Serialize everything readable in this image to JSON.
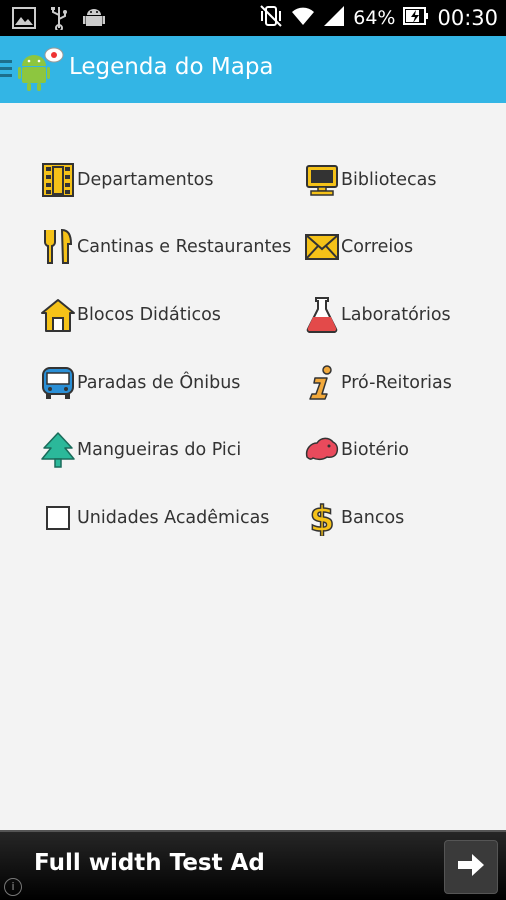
{
  "status_bar": {
    "battery": "64%",
    "time": "00:30",
    "icons": [
      "image-icon",
      "usb-icon",
      "android-debug-icon",
      "vibrate-icon",
      "wifi-icon",
      "signal-icon",
      "battery-charging-icon"
    ]
  },
  "action_bar": {
    "title": "Legenda do Mapa",
    "color": "#33b5e5"
  },
  "legend": {
    "left_column": [
      {
        "label": "Departamentos",
        "icon": "building-icon"
      },
      {
        "label": "Cantinas e Restaurantes",
        "icon": "fork-knife-icon"
      },
      {
        "label": "Blocos Didáticos",
        "icon": "house-icon"
      },
      {
        "label": "Paradas de Ônibus",
        "icon": "bus-icon"
      },
      {
        "label": "Mangueiras do Pici",
        "icon": "tree-icon"
      },
      {
        "label": "Unidades Acadêmicas",
        "icon": "checkbox-icon"
      }
    ],
    "right_column": [
      {
        "label": "Bibliotecas",
        "icon": "computer-icon"
      },
      {
        "label": "Correios",
        "icon": "mail-icon"
      },
      {
        "label": "Laboratórios",
        "icon": "flask-icon"
      },
      {
        "label": "Pró-Reitorias",
        "icon": "info-icon"
      },
      {
        "label": "Biotério",
        "icon": "rat-icon"
      },
      {
        "label": "Bancos",
        "icon": "dollar-icon"
      }
    ]
  },
  "ad": {
    "text": "Full width Test Ad",
    "info": "i"
  }
}
